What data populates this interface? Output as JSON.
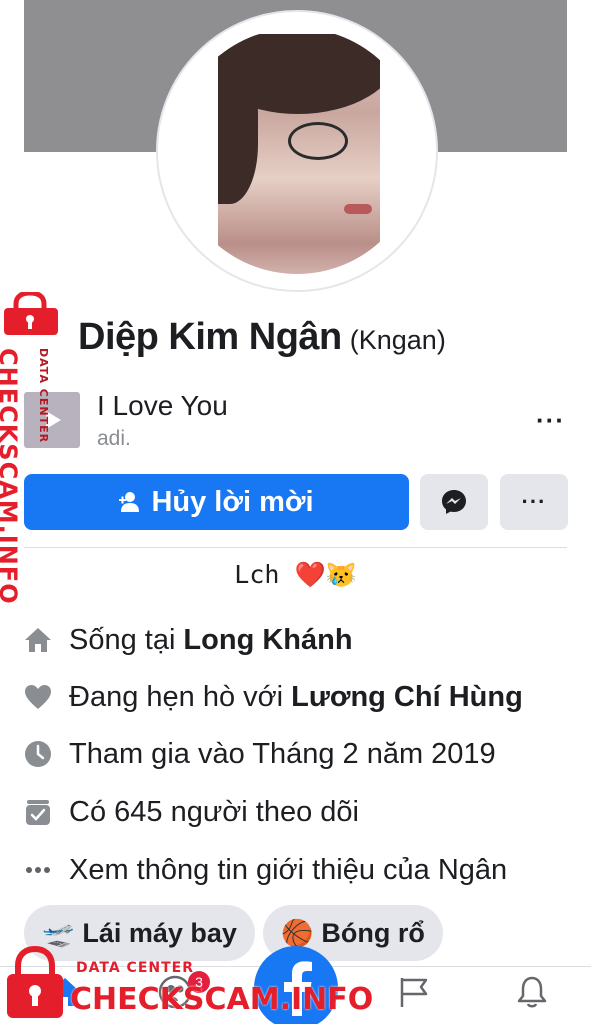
{
  "profile": {
    "name": "Diệp Kim Ngân",
    "nickname": "(Kngan)",
    "bio": "Lch ❤️😿"
  },
  "music": {
    "title": "I Love You",
    "artist": "adi.",
    "more_label": "···"
  },
  "actions": {
    "primary_label": "Hủy lời mời",
    "more_label": "···"
  },
  "info": [
    {
      "prefix": "Sống tại",
      "value": "Long Khánh",
      "icon": "home-icon"
    },
    {
      "prefix": "Đang hẹn hò với",
      "value": "Lương Chí Hùng",
      "icon": "heart-icon"
    },
    {
      "prefix": "Tham gia vào Tháng 2 năm 2019",
      "value": "",
      "icon": "clock-icon"
    },
    {
      "prefix": "Có 645 người theo dõi",
      "value": "",
      "icon": "followers-icon"
    },
    {
      "prefix": "Xem thông tin giới thiệu của Ngân",
      "value": "",
      "icon": "ellipsis-icon"
    }
  ],
  "hobbies": [
    {
      "emoji": "🛫",
      "label": "Lái máy bay"
    },
    {
      "emoji": "🏀",
      "label": "Bóng rổ"
    }
  ],
  "tabbar": {
    "friends_badge": "3"
  },
  "watermark": {
    "site": "CHECKSCAM.INFO",
    "tag": "DATA CENTER"
  },
  "colors": {
    "accent": "#1877f2",
    "watermark": "#e41e2b"
  }
}
